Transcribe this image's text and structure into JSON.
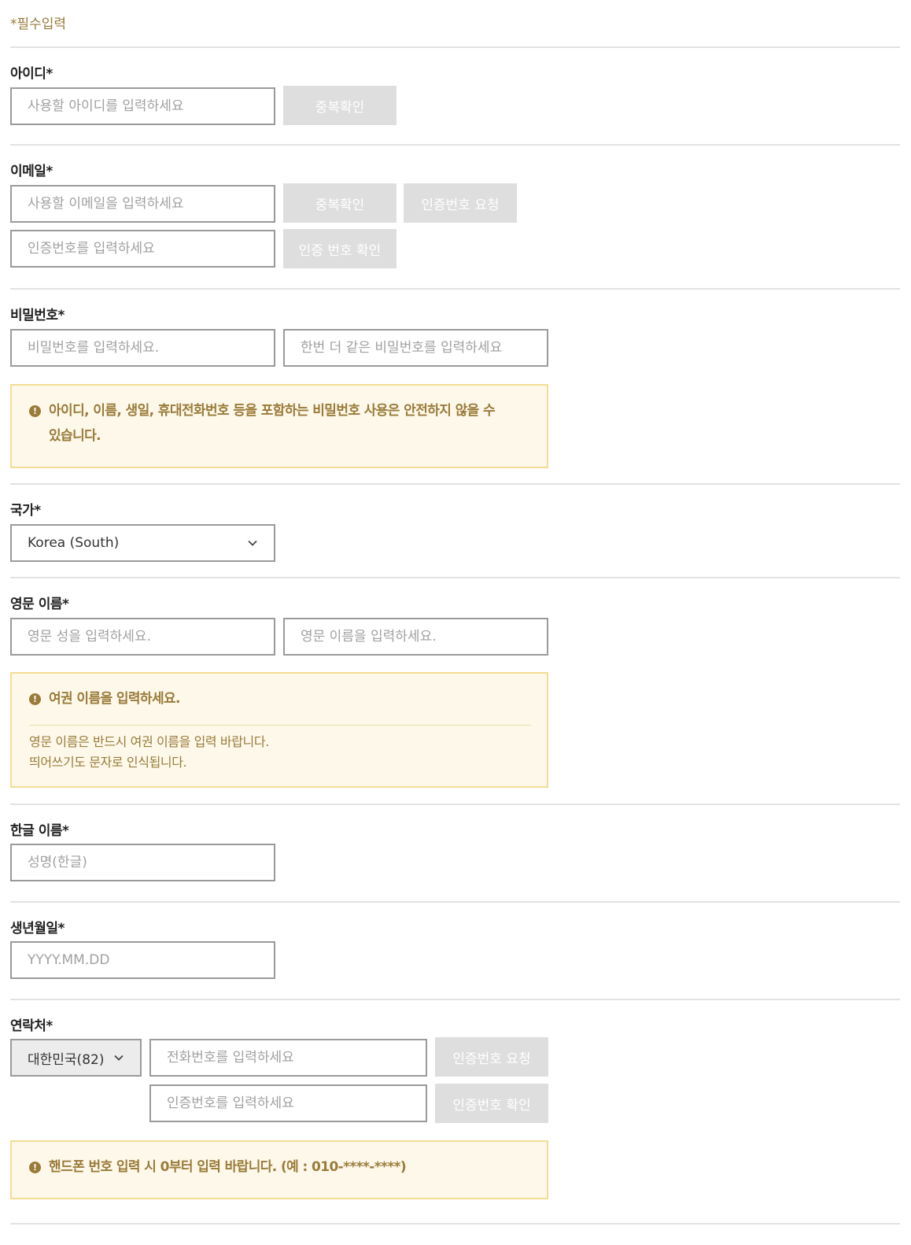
{
  "required_note": "*필수입력",
  "id_section": {
    "label": "아이디*",
    "placeholder": "사용할 아이디를 입력하세요",
    "check_button": "중복확인"
  },
  "email_section": {
    "label": "이메일*",
    "placeholder": "사용할 이메일을 입력하세요",
    "check_button": "중복확인",
    "request_code_button": "인증번호 요청",
    "code_placeholder": "인증번호를 입력하세요",
    "verify_code_button": "인증 번호 확인"
  },
  "password_section": {
    "label": "비밀번호*",
    "placeholder": "비밀번호를 입력하세요.",
    "confirm_placeholder": "한번 더 같은 비밀번호를 입력하세요",
    "notice": "아이디, 이름, 생일, 휴대전화번호 등을 포함하는 비밀번호 사용은 안전하지 않을 수 있습니다."
  },
  "country_section": {
    "label": "국가*",
    "selected": "Korea (South)"
  },
  "english_name_section": {
    "label": "영문 이름*",
    "last_name_placeholder": "영문 성을 입력하세요.",
    "first_name_placeholder": "영문 이름을 입력하세요.",
    "notice_title": "여권 이름을 입력하세요.",
    "notice_line1": "영문 이름은 반드시 여권 이름을 입력 바랍니다.",
    "notice_line2": "띄어쓰기도 문자로 인식됩니다."
  },
  "korean_name_section": {
    "label": "한글 이름*",
    "placeholder": "성명(한글)"
  },
  "birth_section": {
    "label": "생년월일*",
    "placeholder": "YYYY.MM.DD"
  },
  "contact_section": {
    "label": "연락처*",
    "country_code": "대한민국(82)",
    "phone_placeholder": "전화번호를 입력하세요",
    "request_code_button": "인증번호 요청",
    "code_placeholder": "인증번호를 입력하세요",
    "verify_code_button": "인증번호 확인",
    "notice": "핸드폰 번호 입력 시 0부터 입력 바랍니다. (예 : 010-****-****)"
  },
  "icons": {
    "warning": "exclamation-circle-icon",
    "dropdown": "chevron-down-icon"
  },
  "colors": {
    "accent": "#9a7b3a",
    "notice_bg": "#fdf8ea",
    "notice_border": "#f3dd94",
    "disabled_button": "#dedede"
  }
}
